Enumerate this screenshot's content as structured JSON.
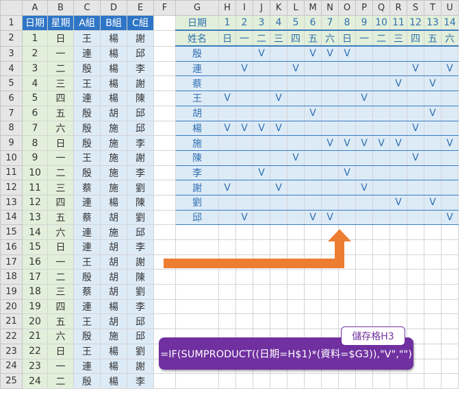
{
  "col_headers": [
    "A",
    "B",
    "C",
    "D",
    "E",
    "F",
    "G",
    "H",
    "I",
    "J",
    "K",
    "L",
    "M",
    "N",
    "O",
    "P",
    "Q",
    "R",
    "S",
    "T",
    "U"
  ],
  "left_headers": [
    "日期",
    "星期",
    "A組",
    "B組",
    "C組"
  ],
  "left_rows": [
    [
      "1",
      "日",
      "王",
      "楊",
      "謝"
    ],
    [
      "2",
      "一",
      "連",
      "楊",
      "邱"
    ],
    [
      "3",
      "二",
      "殷",
      "楊",
      "李"
    ],
    [
      "4",
      "三",
      "王",
      "楊",
      "謝"
    ],
    [
      "5",
      "四",
      "連",
      "楊",
      "陳"
    ],
    [
      "6",
      "五",
      "殷",
      "胡",
      "邱"
    ],
    [
      "7",
      "六",
      "殷",
      "施",
      "邱"
    ],
    [
      "8",
      "日",
      "殷",
      "施",
      "李"
    ],
    [
      "9",
      "一",
      "王",
      "施",
      "謝"
    ],
    [
      "10",
      "二",
      "殷",
      "施",
      "李"
    ],
    [
      "11",
      "三",
      "蔡",
      "施",
      "劉"
    ],
    [
      "12",
      "四",
      "連",
      "楊",
      "陳"
    ],
    [
      "13",
      "五",
      "蔡",
      "胡",
      "劉"
    ],
    [
      "14",
      "六",
      "連",
      "施",
      "邱"
    ],
    [
      "15",
      "日",
      "連",
      "胡",
      "李"
    ],
    [
      "16",
      "一",
      "王",
      "胡",
      "謝"
    ],
    [
      "17",
      "二",
      "殷",
      "胡",
      "陳"
    ],
    [
      "18",
      "三",
      "蔡",
      "胡",
      "劉"
    ],
    [
      "19",
      "四",
      "連",
      "楊",
      "李"
    ],
    [
      "20",
      "五",
      "王",
      "胡",
      "邱"
    ],
    [
      "21",
      "六",
      "殷",
      "施",
      "邱"
    ],
    [
      "22",
      "日",
      "王",
      "楊",
      "劉"
    ],
    [
      "23",
      "一",
      "連",
      "楊",
      "謝"
    ],
    [
      "24",
      "二",
      "殷",
      "楊",
      "李"
    ]
  ],
  "grid": {
    "header1_label": "日期",
    "header2_label": "姓名",
    "dates": [
      "1",
      "2",
      "3",
      "4",
      "5",
      "6",
      "7",
      "8",
      "9",
      "10",
      "11",
      "12",
      "13",
      "14"
    ],
    "weekdays": [
      "日",
      "一",
      "二",
      "三",
      "四",
      "五",
      "六",
      "日",
      "一",
      "二",
      "三",
      "四",
      "五",
      "六"
    ],
    "names": [
      "殷",
      "連",
      "蔡",
      "王",
      "胡",
      "楊",
      "施",
      "陳",
      "李",
      "謝",
      "劉",
      "邱"
    ],
    "marks": [
      [
        "",
        "",
        "V",
        "",
        "",
        "V",
        "V",
        "V",
        "",
        "",
        "",
        "",
        "",
        ""
      ],
      [
        "",
        "V",
        "",
        "",
        "V",
        "",
        "",
        "",
        "",
        "",
        "",
        "V",
        "",
        "V"
      ],
      [
        "",
        "",
        "",
        "",
        "",
        "",
        "",
        "",
        "",
        "",
        "V",
        "",
        "V",
        ""
      ],
      [
        "V",
        "",
        "",
        "V",
        "",
        "",
        "",
        "",
        "V",
        "",
        "",
        "",
        "",
        ""
      ],
      [
        "",
        "",
        "",
        "",
        "",
        "V",
        "",
        "",
        "",
        "",
        "",
        "",
        "V",
        ""
      ],
      [
        "V",
        "V",
        "V",
        "V",
        "",
        "",
        "",
        "",
        "",
        "",
        "",
        "V",
        "",
        ""
      ],
      [
        "",
        "",
        "",
        "",
        "",
        "",
        "V",
        "V",
        "V",
        "V",
        "V",
        "",
        "",
        "V"
      ],
      [
        "",
        "",
        "",
        "",
        "V",
        "",
        "",
        "",
        "",
        "",
        "",
        "V",
        "",
        ""
      ],
      [
        "",
        "",
        "V",
        "",
        "",
        "",
        "",
        "V",
        "",
        "",
        "",
        "",
        "",
        ""
      ],
      [
        "V",
        "",
        "",
        "V",
        "",
        "",
        "",
        "",
        "V",
        "",
        "",
        "",
        "",
        ""
      ],
      [
        "",
        "",
        "",
        "",
        "",
        "",
        "",
        "",
        "",
        "",
        "V",
        "",
        "V",
        ""
      ],
      [
        "",
        "V",
        "",
        "",
        "",
        "V",
        "V",
        "",
        "",
        "",
        "",
        "",
        "",
        "V"
      ]
    ]
  },
  "callout": {
    "cell_label": "儲存格H3",
    "formula": "=IF(SUMPRODUCT((日期=H$1)*(資料=$G3)),\"V\",\"\")"
  },
  "colors": {
    "header_blue": "#2e75c6",
    "light_green": "#e2efda",
    "light_blue": "#ddebf7",
    "arrow_orange": "#ed7d31",
    "callout_purple": "#7030a0"
  }
}
